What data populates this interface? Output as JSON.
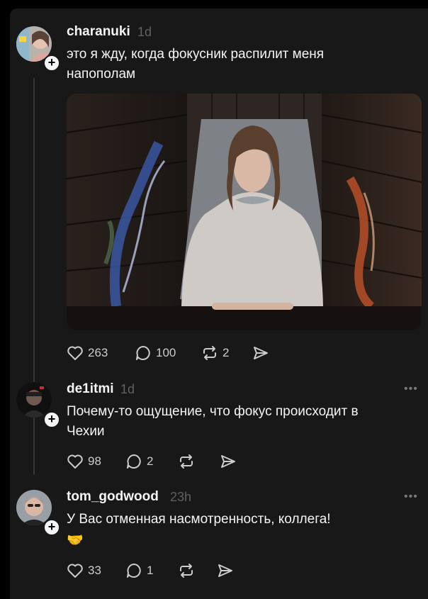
{
  "colors": {
    "background": "#181818",
    "text": "#f3f5f7",
    "muted": "#616161",
    "icon": "#cccccc"
  },
  "post": {
    "username": "charanuki",
    "time": "1d",
    "text_line1": "это я жду, когда фокусник распилит меня",
    "text_line2": "напополам",
    "image_icon": "photo-of-woman-in-wooden-box",
    "likes": "263",
    "replies": "100",
    "reposts": "2"
  },
  "replies": [
    {
      "username": "de1itmi",
      "time": "1d",
      "text_line1": "Почему-то ощущение, что  фокус происходит в",
      "text_line2": "Чехии",
      "likes": "98",
      "replies": "2",
      "more": "•••"
    },
    {
      "username": "tom_godwood",
      "time": "23h",
      "text_line1": "У Вас отменная насмотренность, коллега!",
      "text_line2": "🤝",
      "likes": "33",
      "replies": "1",
      "more": "•••"
    }
  ],
  "icons": {
    "like": "heart-icon",
    "reply": "speech-bubble-icon",
    "repost": "repost-icon",
    "share": "send-icon",
    "follow": "plus-icon"
  }
}
